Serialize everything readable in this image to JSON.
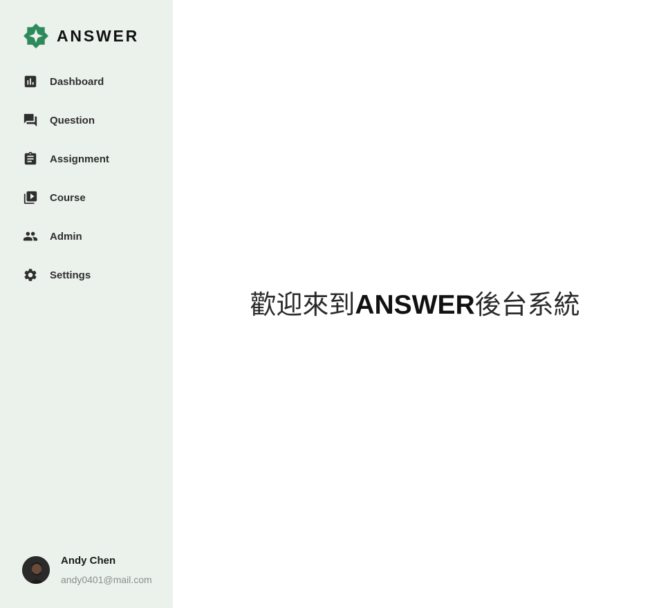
{
  "brand": {
    "name": "ANSWER",
    "icon": "answer-logo-icon",
    "color": "#2f8a5b"
  },
  "sidebar": {
    "background": "#ebf2ec",
    "items": [
      {
        "label": "Dashboard",
        "icon": "bar-chart-icon"
      },
      {
        "label": "Question",
        "icon": "forum-icon"
      },
      {
        "label": "Assignment",
        "icon": "clipboard-icon"
      },
      {
        "label": "Course",
        "icon": "video-library-icon"
      },
      {
        "label": "Admin",
        "icon": "people-icon"
      },
      {
        "label": "Settings",
        "icon": "gear-icon"
      }
    ]
  },
  "user": {
    "name": "Andy Chen",
    "email": "andy0401@mail.com",
    "avatar": "user-avatar"
  },
  "main": {
    "welcome_prefix": "歡迎來到",
    "welcome_brand": "ANSWER",
    "welcome_suffix": "後台系統"
  }
}
